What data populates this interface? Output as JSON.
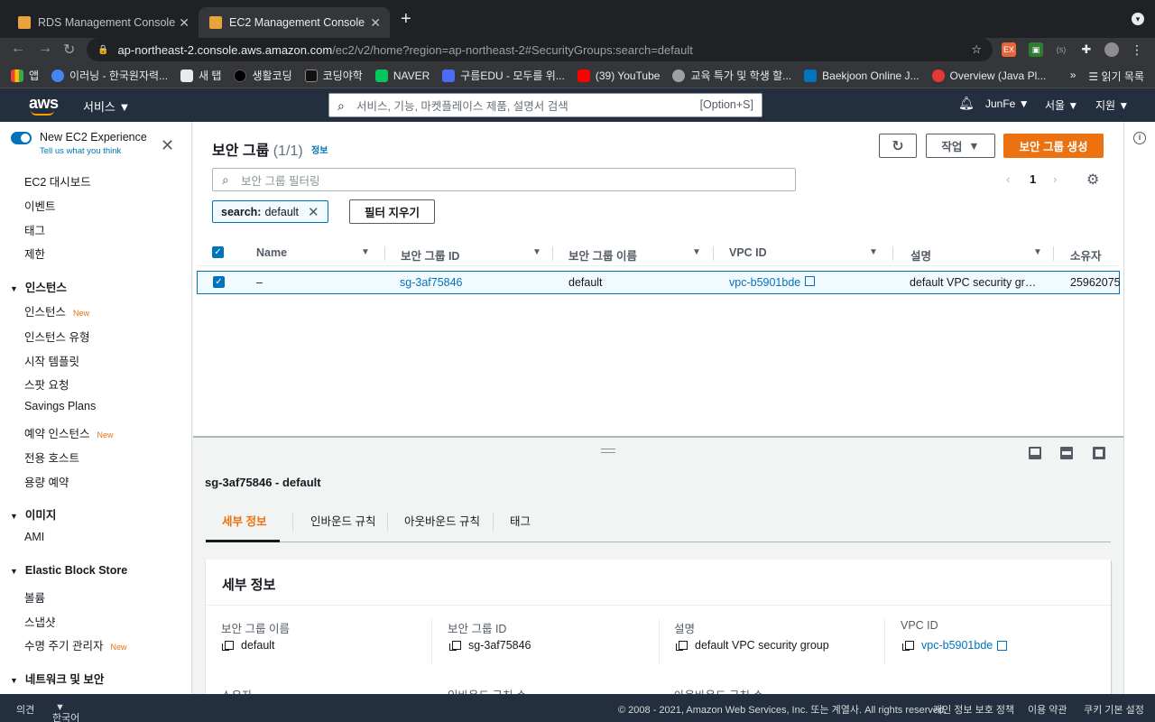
{
  "browser": {
    "tabs": [
      {
        "title": "RDS Management Console"
      },
      {
        "title": "EC2 Management Console"
      }
    ],
    "url_host": "ap-northeast-2.console.aws.amazon.com",
    "url_path": "/ec2/v2/home?region=ap-northeast-2#SecurityGroups:search=default",
    "bookmarks": [
      {
        "label": "앱",
        "color": "#ea4335"
      },
      {
        "label": "이러닝 - 한국원자력...",
        "color": "#4285f4"
      },
      {
        "label": "새 탭",
        "color": "#e8eaed"
      },
      {
        "label": "생활코딩",
        "color": "#000000"
      },
      {
        "label": "코딩야학",
        "color": "#111111"
      },
      {
        "label": "NAVER",
        "color": "#03c75a"
      },
      {
        "label": "구름EDU - 모두를 위...",
        "color": "#4a6cf7"
      },
      {
        "label": "(39) YouTube",
        "color": "#ff0000"
      },
      {
        "label": "교육 특가 및 학생 할...",
        "color": "#9aa0a6"
      },
      {
        "label": "Baekjoon Online J...",
        "color": "#0076c0"
      },
      {
        "label": "Overview (Java Pl...",
        "color": "#e53935"
      }
    ],
    "more": "»",
    "reading_list": "읽기 목록"
  },
  "aws_header": {
    "logo": "aws",
    "services": "서비스",
    "search_placeholder": "서비스, 기능, 마켓플레이스 제품, 설명서 검색",
    "search_shortcut": "[Option+S]",
    "user": "JunFe",
    "region": "서울",
    "support": "지원"
  },
  "sidebar": {
    "new_experience": "New EC2 Experience",
    "tell_us": "Tell us what you think",
    "top_items": [
      "EC2 대시보드",
      "이벤트",
      "태그",
      "제한"
    ],
    "sections": [
      {
        "title": "인스턴스",
        "items": [
          {
            "label": "인스턴스",
            "new": "New"
          },
          {
            "label": "인스턴스 유형",
            "new": ""
          },
          {
            "label": "시작 템플릿",
            "new": ""
          },
          {
            "label": "스팟 요청",
            "new": ""
          },
          {
            "label": "Savings Plans",
            "new": ""
          },
          {
            "label": "예약 인스턴스",
            "new": "New"
          },
          {
            "label": "전용 호스트",
            "new": ""
          },
          {
            "label": "용량 예약",
            "new": ""
          }
        ]
      },
      {
        "title": "이미지",
        "items": [
          {
            "label": "AMI",
            "new": ""
          }
        ]
      },
      {
        "title": "Elastic Block Store",
        "items": [
          {
            "label": "볼륨",
            "new": ""
          },
          {
            "label": "스냅샷",
            "new": ""
          },
          {
            "label": "수명 주기 관리자",
            "new": "New"
          }
        ]
      },
      {
        "title": "네트워크 및 보안",
        "items": []
      }
    ]
  },
  "main": {
    "title": "보안 그룹",
    "count": "(1/1)",
    "info": "정보",
    "actions": "작업",
    "create": "보안 그룹 생성",
    "filter_placeholder": "보안 그룹 필터링",
    "page": "1",
    "token_key": "search:",
    "token_value": "default",
    "clear_filters": "필터 지우기",
    "columns": [
      "Name",
      "보안 그룹 ID",
      "보안 그룹 이름",
      "VPC ID",
      "설명",
      "소유자"
    ],
    "row": {
      "name": "–",
      "sg_id": "sg-3af75846",
      "sg_name": "default",
      "vpc_id": "vpc-b5901bde",
      "description": "default VPC security gr…",
      "owner": "25962075"
    }
  },
  "details": {
    "title": "sg-3af75846 - default",
    "tabs": [
      "세부 정보",
      "인바운드 규칙",
      "아웃바운드 규칙",
      "태그"
    ],
    "card_title": "세부 정보",
    "fields": [
      {
        "label": "보안 그룹 이름",
        "value": "default"
      },
      {
        "label": "보안 그룹 ID",
        "value": "sg-3af75846"
      },
      {
        "label": "설명",
        "value": "default VPC security group"
      },
      {
        "label": "VPC ID",
        "value": "vpc-b5901bde"
      }
    ],
    "row2_labels": [
      "소유자",
      "인바운드 규칙 수",
      "아웃바운드 규칙 수"
    ]
  },
  "footer": {
    "feedback": "의견",
    "language": "한국어",
    "copyright": "© 2008 - 2021, Amazon Web Services, Inc. 또는 계열사. All rights reserved.",
    "privacy": "개인 정보 보호 정책",
    "terms": "이용 약관",
    "cookies": "쿠키 기본 설정"
  },
  "colors": {
    "accent": "#ec7211",
    "link": "#0073bb",
    "header": "#232f3e"
  }
}
